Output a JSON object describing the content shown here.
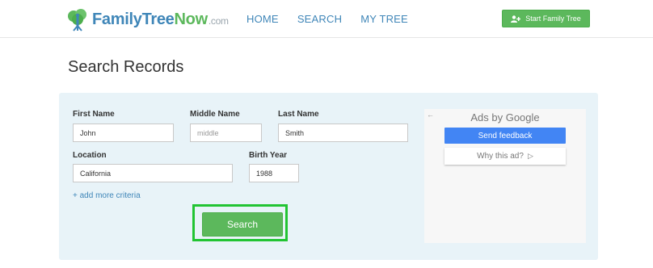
{
  "brand": {
    "part1": "Family",
    "part2": "Tree",
    "part3": "Now",
    "suffix": ".com"
  },
  "nav": [
    {
      "label": "HOME"
    },
    {
      "label": "SEARCH"
    },
    {
      "label": "MY TREE"
    }
  ],
  "header_button": {
    "label": "Start Family Tree",
    "icon": "add-user-icon"
  },
  "page_title": "Search Records",
  "form": {
    "first_name": {
      "label": "First Name",
      "value": "John",
      "placeholder": ""
    },
    "middle_name": {
      "label": "Middle Name",
      "value": "",
      "placeholder": "middle"
    },
    "last_name": {
      "label": "Last Name",
      "value": "Smith",
      "placeholder": ""
    },
    "location": {
      "label": "Location",
      "value": "California",
      "placeholder": ""
    },
    "birth_year": {
      "label": "Birth Year",
      "value": "1988",
      "placeholder": ""
    },
    "more_criteria": "+ add more criteria",
    "search_label": "Search"
  },
  "ad": {
    "back": "←",
    "title": "Ads by Google",
    "feedback": "Send feedback",
    "why": "Why this ad?",
    "why_icon": "▷"
  },
  "colors": {
    "brand_blue": "#3f86b8",
    "brand_green": "#5cb85c",
    "panel_bg": "#e8f3f8",
    "highlight": "#22c433",
    "google_blue": "#4285f4"
  }
}
